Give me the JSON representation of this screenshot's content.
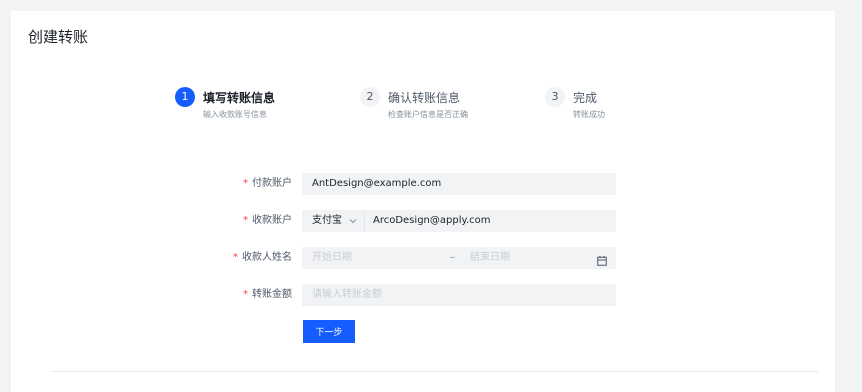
{
  "card": {
    "title": "创建转账"
  },
  "steps": [
    {
      "number": "1",
      "title": "填写转账信息",
      "desc": "输入收款账号信息"
    },
    {
      "number": "2",
      "title": "确认转账信息",
      "desc": "检查账户信息是否正确"
    },
    {
      "number": "3",
      "title": "完成",
      "desc": "转账成功"
    }
  ],
  "form": {
    "required_mark": "*",
    "payer": {
      "label": "付款账户",
      "value": "AntDesign@example.com"
    },
    "payee": {
      "label": "收款账户",
      "channel": "支付宝",
      "value": "ArcoDesign@apply.com"
    },
    "name": {
      "label": "收款人姓名",
      "start_placeholder": "开始日期",
      "separator": "–",
      "end_placeholder": "结束日期"
    },
    "amount": {
      "label": "转账金额",
      "placeholder": "请输入转账金额"
    },
    "next_button": "下一步"
  },
  "icons": {
    "chevron": "chevron-down-icon",
    "calendar": "calendar-icon"
  },
  "colors": {
    "primary": "#165dff",
    "required": "#f53f3f"
  }
}
